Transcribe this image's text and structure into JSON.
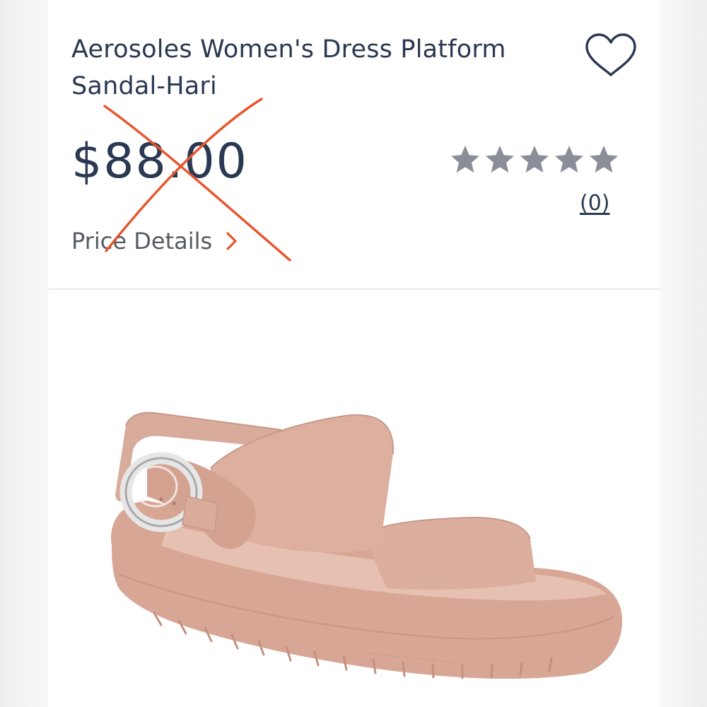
{
  "product": {
    "title_line1": "Aerosoles Women's Dress Platform",
    "title_line2": "Sandal-Hari",
    "price": "$88.00",
    "price_details_label": "Price Details",
    "rating": {
      "stars_filled": 0,
      "stars_total": 5,
      "review_count": "(0)"
    },
    "image_alt": "Blush pink platform sandal with silver buckle"
  },
  "colors": {
    "text_primary": "#2a3852",
    "text_secondary": "#545b63",
    "star_empty": "#8a8e98",
    "scribble_red": "#e8542a",
    "sandal_blush": "#dcaf9f"
  },
  "icons": {
    "favorite": "heart-outline-icon",
    "details_chevron": "chevron-right-icon",
    "rating": "star-icon"
  }
}
